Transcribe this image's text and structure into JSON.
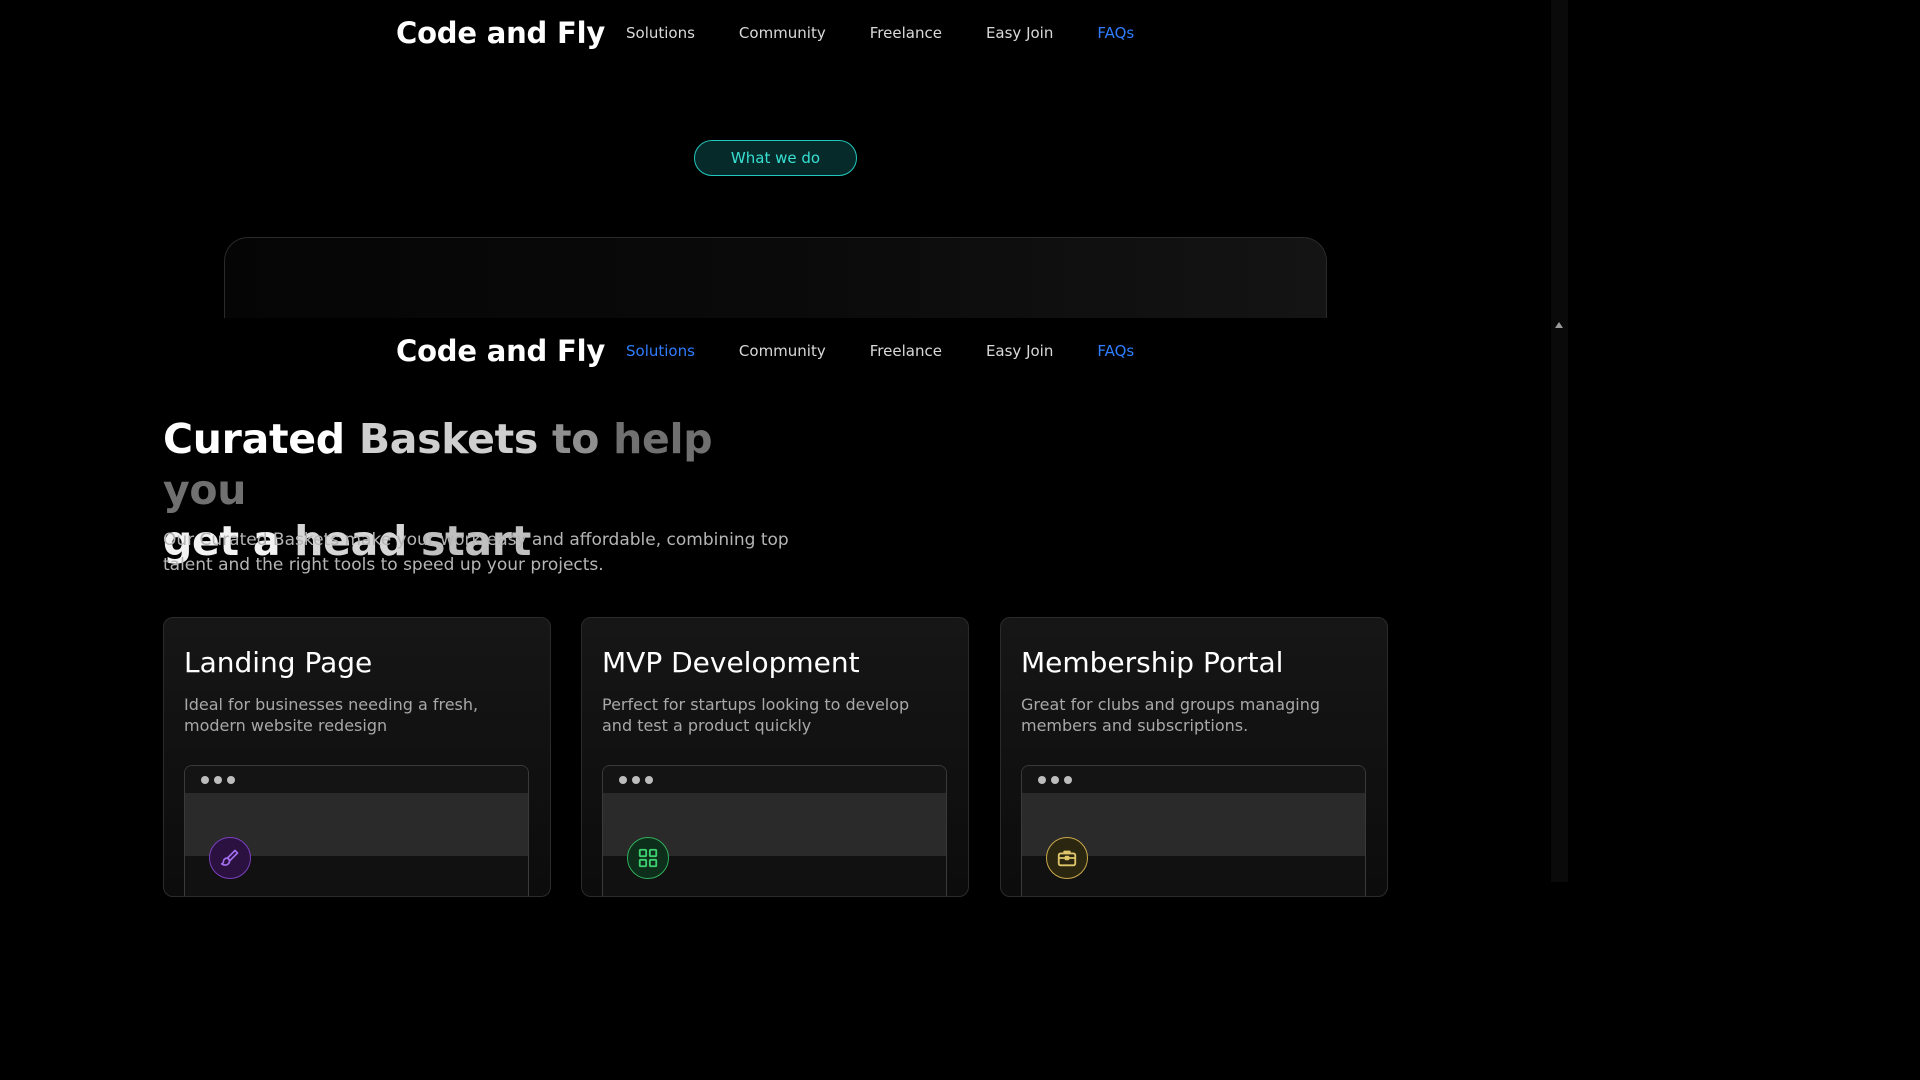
{
  "brand": "Code and Fly",
  "nav_top": {
    "links": [
      "Solutions",
      "Community",
      "Freelance",
      "Easy Join",
      "FAQs"
    ]
  },
  "nav_sticky": {
    "links": [
      "Solutions",
      "Community",
      "Freelance",
      "Easy Join",
      "FAQs"
    ]
  },
  "pill_label": "What we do",
  "section": {
    "title_parts": [
      "Curated",
      "Baskets",
      "to",
      "help",
      "you",
      "get",
      "a",
      "head",
      "start"
    ],
    "description": "Our Curated Baskets make your work easy and affordable, combining top talent and the right tools to speed up your projects."
  },
  "cards": [
    {
      "title": "Landing Page",
      "description": "Ideal for businesses needing a fresh, modern website redesign",
      "icon": "paint-brush-icon",
      "accent": "#7b3fbf"
    },
    {
      "title": "MVP Development",
      "description": "Perfect for startups looking to develop and test a product quickly",
      "icon": "grid-icon",
      "accent": "#2fae5a"
    },
    {
      "title": "Membership Portal",
      "description": "Great for clubs and groups managing members and subscriptions.",
      "icon": "briefcase-icon",
      "accent": "#c9a94a"
    }
  ],
  "colors": {
    "active_link": "#2f7dff",
    "pill_accent": "#22c6bc",
    "background": "#000000"
  }
}
